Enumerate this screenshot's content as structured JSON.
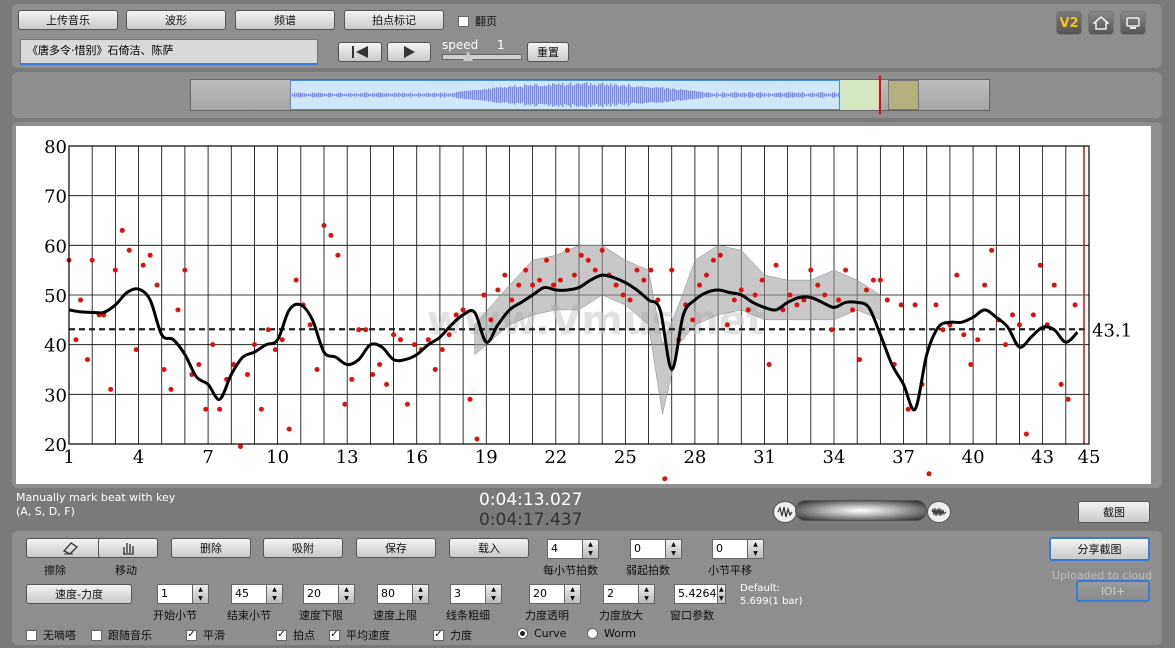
{
  "toolbar": {
    "upload": "上传音乐",
    "waveform": "波形",
    "spectrum": "频谱",
    "tap_mark": "拍点标记",
    "flip_page": "翻页",
    "song_title": "《唐多令·惜别》石倚洁、陈萨",
    "speed_label": "speed",
    "speed_value": "1",
    "reset": "重置",
    "version_badge": "V2"
  },
  "status": {
    "hint_line1": "Manually mark beat with key",
    "hint_line2": "(A, S, D, F)",
    "time_current": "0:04:13.027",
    "time_total": "0:04:17.437",
    "screenshot": "截图"
  },
  "controls": {
    "erase": "擦除",
    "move": "移动",
    "delete": "删除",
    "snap": "吸附",
    "save": "保存",
    "load": "载入",
    "speed_force": "速度-力度",
    "share": "分享截图",
    "uploaded": "Uploaded to cloud",
    "ioi": "IOI+",
    "default_line1": "Default:",
    "default_line2": "5.699(1 bar)"
  },
  "steppers_top": [
    {
      "value": "4",
      "label": "每小节拍数"
    },
    {
      "value": "0",
      "label": "弱起拍数"
    },
    {
      "value": "0",
      "label": "小节平移"
    }
  ],
  "steppers_bottom": [
    {
      "value": "1",
      "label": "开始小节"
    },
    {
      "value": "45",
      "label": "结束小节"
    },
    {
      "value": "20",
      "label": "速度下限"
    },
    {
      "value": "80",
      "label": "速度上限"
    },
    {
      "value": "3",
      "label": "线条粗细"
    },
    {
      "value": "20",
      "label": "力度透明"
    },
    {
      "value": "2",
      "label": "力度放大"
    },
    {
      "value": "5.4264",
      "label": "窗口参数"
    }
  ],
  "checkboxes": [
    {
      "label": "无嘀嗒",
      "checked": false
    },
    {
      "label": "跟随音乐",
      "checked": false
    },
    {
      "label": "平滑",
      "checked": true
    },
    {
      "label": "拍点",
      "checked": true
    },
    {
      "label": "平均速度",
      "checked": true
    },
    {
      "label": "力度",
      "checked": true
    }
  ],
  "radios": [
    {
      "label": "Curve",
      "selected": true
    },
    {
      "label": "Worm",
      "selected": false
    }
  ],
  "chart_data": {
    "type": "line",
    "title": "",
    "xlabel": "",
    "ylabel": "",
    "xlim": [
      1,
      45
    ],
    "ylim": [
      20,
      80
    ],
    "x_ticks": [
      1,
      4,
      7,
      10,
      13,
      16,
      19,
      22,
      25,
      28,
      31,
      34,
      37,
      40,
      43,
      45
    ],
    "y_ticks": [
      20,
      30,
      40,
      50,
      60,
      70,
      80
    ],
    "average_label": "43.1",
    "average": 43.1,
    "watermark": "www.Vmus.net",
    "smooth_tempo": {
      "x": [
        1,
        1.5,
        2,
        2.5,
        3,
        3.5,
        4,
        4.5,
        5,
        5.5,
        6,
        6.5,
        7,
        7.5,
        8,
        8.5,
        9,
        9.5,
        10,
        10.5,
        11,
        11.5,
        12,
        12.5,
        13,
        13.5,
        14,
        14.5,
        15,
        15.5,
        16,
        16.5,
        17,
        17.5,
        18,
        18.5,
        19,
        19.5,
        20,
        20.5,
        21,
        21.5,
        22,
        22.5,
        23,
        23.5,
        24,
        24.5,
        25,
        25.5,
        26,
        26.5,
        27,
        27.5,
        28,
        28.5,
        29,
        29.5,
        30,
        30.5,
        31,
        31.5,
        32,
        32.5,
        33,
        33.5,
        34,
        34.5,
        35,
        35.5,
        36,
        36.5,
        37,
        37.5,
        38,
        38.5,
        39,
        39.5,
        40,
        40.5,
        41,
        41.5,
        42,
        42.5,
        43,
        43.5,
        44,
        44.5
      ],
      "y": [
        47,
        46.6,
        46.5,
        46.5,
        48,
        50.5,
        51.2,
        49,
        42,
        41,
        38,
        33.5,
        32,
        29,
        34,
        37.5,
        38.5,
        40,
        41,
        47,
        48,
        45,
        38.5,
        37.5,
        36,
        37,
        40,
        39.5,
        37,
        37,
        38,
        40,
        41.5,
        44,
        46,
        46.5,
        40.5,
        44,
        47,
        48.5,
        50,
        51.5,
        51,
        51,
        51.5,
        53,
        54,
        53.5,
        52.5,
        51,
        49,
        47,
        35,
        46,
        49,
        50.5,
        51,
        50.5,
        50,
        48.5,
        47.5,
        47,
        48.5,
        49.5,
        49.5,
        48.5,
        47.5,
        48.5,
        48.5,
        47.5,
        42,
        36,
        32,
        27,
        38,
        43.5,
        44.5,
        44.5,
        45.5,
        47,
        45.5,
        43.5,
        39.5,
        41.5,
        43.5,
        43,
        40.5,
        42.5
      ]
    },
    "force_band": [
      {
        "x": 18.5,
        "lo": 38,
        "hi": 44
      },
      {
        "x": 20,
        "lo": 44,
        "hi": 52
      },
      {
        "x": 21,
        "lo": 46,
        "hi": 57
      },
      {
        "x": 22,
        "lo": 47,
        "hi": 58
      },
      {
        "x": 23,
        "lo": 47,
        "hi": 60
      },
      {
        "x": 24,
        "lo": 50,
        "hi": 60
      },
      {
        "x": 25,
        "lo": 48,
        "hi": 57
      },
      {
        "x": 26,
        "lo": 44,
        "hi": 55
      },
      {
        "x": 26.6,
        "lo": 26,
        "hi": 40
      },
      {
        "x": 27.3,
        "lo": 40,
        "hi": 48
      },
      {
        "x": 28,
        "lo": 44,
        "hi": 57
      },
      {
        "x": 29,
        "lo": 46,
        "hi": 60
      },
      {
        "x": 30,
        "lo": 47,
        "hi": 59
      },
      {
        "x": 31,
        "lo": 45,
        "hi": 54
      },
      {
        "x": 32,
        "lo": 45,
        "hi": 53
      },
      {
        "x": 33,
        "lo": 45,
        "hi": 53
      },
      {
        "x": 34,
        "lo": 45,
        "hi": 55
      },
      {
        "x": 35,
        "lo": 47,
        "hi": 53
      },
      {
        "x": 36,
        "lo": 45,
        "hi": 50
      }
    ],
    "beat_points": {
      "x": [
        1,
        1.3,
        1.5,
        1.8,
        2,
        2.3,
        2.5,
        2.8,
        3,
        3.3,
        3.6,
        3.9,
        4.2,
        4.5,
        4.8,
        5.1,
        5.4,
        5.7,
        6,
        6.3,
        6.6,
        6.9,
        7.2,
        7.5,
        7.8,
        8.1,
        8.4,
        8.7,
        9,
        9.3,
        9.6,
        9.9,
        10.2,
        10.5,
        10.8,
        11.1,
        11.4,
        11.7,
        12,
        12.3,
        12.6,
        12.9,
        13.2,
        13.5,
        13.8,
        14.1,
        14.4,
        14.7,
        15,
        15.3,
        15.6,
        15.9,
        16.2,
        16.5,
        16.8,
        17.1,
        17.4,
        17.7,
        18,
        18.3,
        18.6,
        18.9,
        19.2,
        19.5,
        19.8,
        20.1,
        20.4,
        20.7,
        21,
        21.3,
        21.6,
        21.9,
        22.2,
        22.5,
        22.8,
        23.1,
        23.4,
        23.7,
        24,
        24.3,
        24.6,
        24.9,
        25.2,
        25.5,
        25.8,
        26.1,
        26.4,
        26.7,
        27,
        27.3,
        27.6,
        27.9,
        28.2,
        28.5,
        28.8,
        29.1,
        29.4,
        29.7,
        30,
        30.3,
        30.6,
        30.9,
        31.2,
        31.5,
        31.8,
        32.1,
        32.4,
        32.7,
        33,
        33.3,
        33.6,
        33.9,
        34.2,
        34.5,
        34.8,
        35.1,
        35.4,
        35.7,
        36,
        36.3,
        36.6,
        36.9,
        37.2,
        37.5,
        37.8,
        38.1,
        38.4,
        38.7,
        39,
        39.3,
        39.6,
        39.9,
        40.2,
        40.5,
        40.8,
        41.1,
        41.4,
        41.7,
        42,
        42.3,
        42.6,
        42.9,
        43.2,
        43.5,
        43.8,
        44.1,
        44.4
      ],
      "y": [
        57,
        41,
        49,
        37,
        57,
        46,
        46,
        31,
        55,
        63,
        59,
        39,
        56,
        58,
        52,
        35,
        31,
        47,
        55,
        34,
        36,
        27,
        40,
        27,
        33,
        36,
        19.5,
        34,
        40,
        27,
        43,
        39,
        41,
        23,
        53,
        48,
        44,
        35,
        64,
        62,
        58,
        28,
        33,
        43,
        43,
        34,
        36,
        32,
        42,
        41,
        28,
        40,
        39,
        41,
        35,
        39,
        42,
        46,
        47,
        29,
        21,
        50,
        45,
        51,
        54,
        49,
        52,
        55,
        52,
        53,
        57,
        52,
        53,
        59,
        54,
        58,
        57,
        55,
        59,
        54,
        52,
        50,
        49,
        55,
        53,
        55,
        49,
        13,
        55,
        41,
        48,
        45,
        52,
        54,
        57,
        58,
        44,
        49,
        51,
        47,
        50,
        53,
        36,
        56,
        47,
        50,
        48,
        49,
        55,
        52,
        50,
        43,
        49,
        55,
        47,
        37,
        51,
        53,
        53,
        49,
        36,
        48,
        27,
        48,
        32,
        14,
        48,
        43,
        44,
        54,
        42,
        36,
        41,
        52,
        59,
        45,
        40,
        46,
        44,
        22,
        46,
        56,
        44,
        52,
        32,
        29,
        48,
        47
      ]
    }
  }
}
